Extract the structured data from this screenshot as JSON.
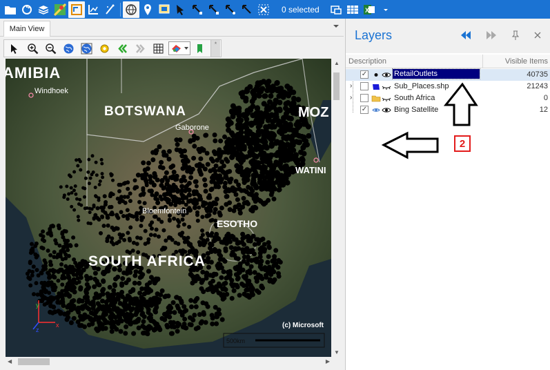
{
  "top_toolbar": {
    "icons": [
      "open-folder-icon",
      "plug-icon",
      "layers-stack-icon",
      "map-pin-colored-icon",
      "table-highlight-icon",
      "chart-axis-icon",
      "wand-icon",
      "globe-icon",
      "pin-icon",
      "select-window-icon",
      "arrow-select-icon",
      "node-select-icon",
      "node-select-2-icon",
      "node-select-3-icon",
      "node-select-4-icon",
      "clear-selection-icon",
      "grid-table-icon",
      "excel-icon",
      "dropdown-icon"
    ],
    "selected_count": "0 selected"
  },
  "main_view": {
    "tab_label": "Main View",
    "toolbar_icons": [
      "pointer-icon",
      "zoom-in-icon",
      "zoom-out-icon",
      "globe-zoom-icon",
      "globe-full-icon",
      "settings-icon",
      "back-icon",
      "forward-icon",
      "grid-icon",
      "theme-picker-icon",
      "bookmark-icon"
    ],
    "map": {
      "labels": [
        "AMIBIA",
        "Windhoek",
        "BOTSWANA",
        "Gaborone",
        "MOZ",
        "WATINI",
        "Bloemfontein",
        "ESOTHO",
        "SOUTH AFRICA"
      ],
      "attribution": "(c) Microsoft",
      "axis_x": "x",
      "axis_y": "y",
      "axis_z": "z",
      "scale_label": "500km"
    }
  },
  "layers": {
    "title": "Layers",
    "header_icons": [
      "collapse-left-icon",
      "expand-right-icon",
      "pin-icon",
      "close-icon"
    ],
    "columns": {
      "description": "Description",
      "visible_items": "Visible Items"
    },
    "rows": [
      {
        "name": "RetailOutlets",
        "count": "40735",
        "checked": "✓",
        "expander": "",
        "selected": true
      },
      {
        "name": "Sub_Places.shp",
        "count": "21243",
        "checked": "",
        "expander": "›",
        "selected": false
      },
      {
        "name": "South Africa",
        "count": "0",
        "checked": "",
        "expander": "›",
        "selected": false
      },
      {
        "name": "Bing Satellite",
        "count": "12",
        "checked": "✓",
        "expander": "",
        "selected": false
      }
    ]
  },
  "annotation": {
    "step_number": "2"
  },
  "colors": {
    "ribbon": "#1b73d3",
    "accent": "#1b73d3",
    "selection": "#00007f",
    "badge": "#e31b1b"
  }
}
